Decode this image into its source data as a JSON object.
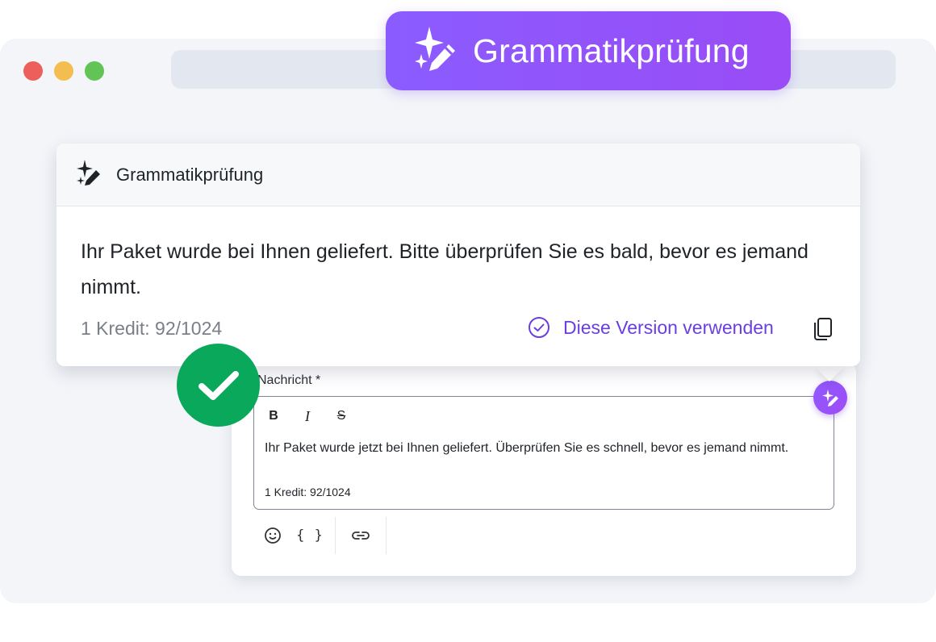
{
  "banner": {
    "title": "Grammatikprüfung",
    "icon": "sparkle-pen-icon",
    "colors": {
      "from": "#8a5cff",
      "to": "#9a4cf6"
    }
  },
  "browser": {
    "controls": [
      "close",
      "minimize",
      "maximize"
    ]
  },
  "popover": {
    "title": "Grammatikprüfung",
    "suggestion": "Ihr Paket wurde bei Ihnen geliefert. Bitte überprüfen Sie es bald, bevor es jemand nimmt.",
    "credit": "1 Kredit: 92/1024",
    "use_version_label": "Diese Version verwenden",
    "accent": "#6a3ee0"
  },
  "editor": {
    "label": "Nachricht *",
    "format_buttons": {
      "bold": "B",
      "italic": "I",
      "strike": "S"
    },
    "text": "Ihr Paket wurde jetzt bei Ihnen geliefert. Überprüfen Sie es schnell, bevor es jemand nimmt.",
    "credit": "1 Kredit: 92/1024",
    "toolbar": {
      "braces": "{ }"
    }
  },
  "status": {
    "success_color": "#0aa85a"
  }
}
